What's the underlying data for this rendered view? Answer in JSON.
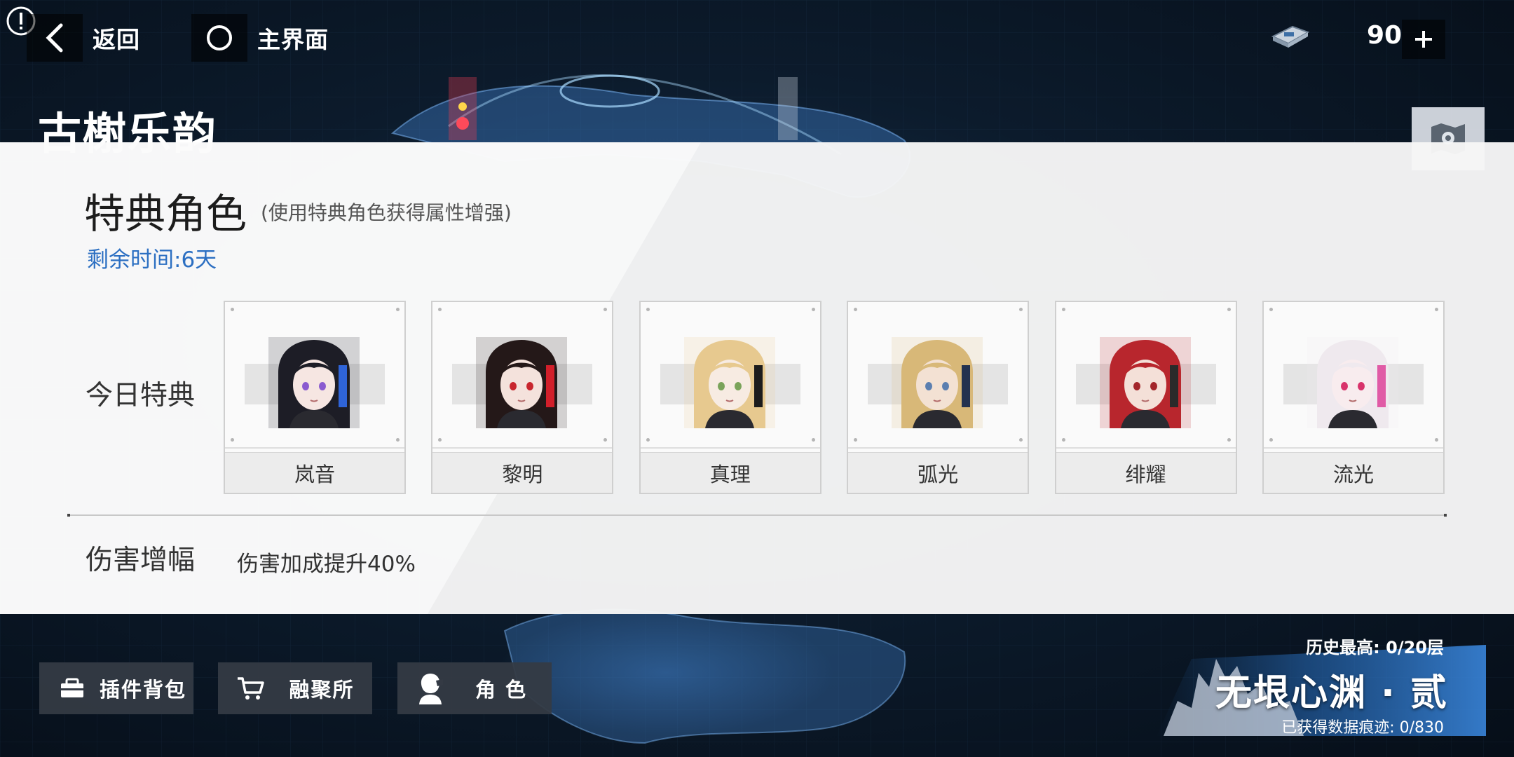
{
  "topbar": {
    "back_label": "返回",
    "home_label": "主界面",
    "currency_value": "90",
    "add_symbol": "+"
  },
  "event": {
    "title": "古榭乐韵"
  },
  "modal": {
    "title": "特典角色",
    "subtitle": "(使用特典角色获得属性增强)",
    "time_remaining": "剩余时间:6天",
    "today_label": "今日特典",
    "bonus_label": "伤害增幅",
    "bonus_text": "伤害加成提升40%",
    "characters": [
      {
        "name": "岚音",
        "hair": "#1d1d26",
        "accent": "#2f64d8",
        "skin": "#f6e6e2",
        "eyes": "#8a5bd0"
      },
      {
        "name": "黎明",
        "hair": "#241818",
        "accent": "#d21f2a",
        "skin": "#f4e2dc",
        "eyes": "#c8262e"
      },
      {
        "name": "真理",
        "hair": "#e7c98f",
        "accent": "#1c1c1c",
        "skin": "#f7ebe2",
        "eyes": "#7aa35a"
      },
      {
        "name": "弧光",
        "hair": "#d8b878",
        "accent": "#23324f",
        "skin": "#f3e1d3",
        "eyes": "#5b7fb0"
      },
      {
        "name": "绯耀",
        "hair": "#b8262d",
        "accent": "#2a2a2a",
        "skin": "#f4e0d8",
        "eyes": "#a3262b"
      },
      {
        "name": "流光",
        "hair": "#efe9ee",
        "accent": "#e05ba6",
        "skin": "#f8ecee",
        "eyes": "#d8336b"
      }
    ]
  },
  "bottombar": {
    "plugin_label": "插件背包",
    "fusion_label": "融聚所",
    "character_label": "角 色"
  },
  "abyss": {
    "best_record": "历史最高: 0/20层",
    "name": "无垠心渊 · 贰",
    "progress": "已获得数据痕迹: 0/830"
  }
}
